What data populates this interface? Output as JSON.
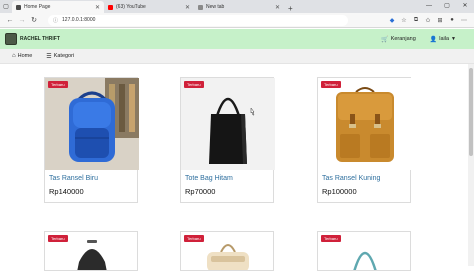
{
  "browser": {
    "tabs": [
      {
        "title": "Home Page",
        "active": true,
        "favicon_color": "#4a4a4a"
      },
      {
        "title": "(63) YouTube",
        "active": false,
        "favicon_color": "#ff0000"
      },
      {
        "title": "New tab",
        "active": false,
        "favicon_color": "#8a8a8a"
      }
    ],
    "url": "127.0.0.1:8000"
  },
  "site": {
    "brand": "RACHEL THRIFT",
    "cart_label": "Keranjang",
    "user_label": "laila",
    "nav": {
      "home": "Home",
      "category": "Kategori"
    }
  },
  "products": [
    {
      "badge": "Terbaru",
      "name": "Tas Ransel Biru",
      "price": "Rp140000"
    },
    {
      "badge": "Terbaru",
      "name": "Tote Bag Hitam",
      "price": "Rp70000"
    },
    {
      "badge": "Terbaru",
      "name": "Tas Ransel Kuning",
      "price": "Rp100000"
    },
    {
      "badge": "Terbaru"
    },
    {
      "badge": "Terbaru"
    },
    {
      "badge": "Terbaru"
    }
  ]
}
